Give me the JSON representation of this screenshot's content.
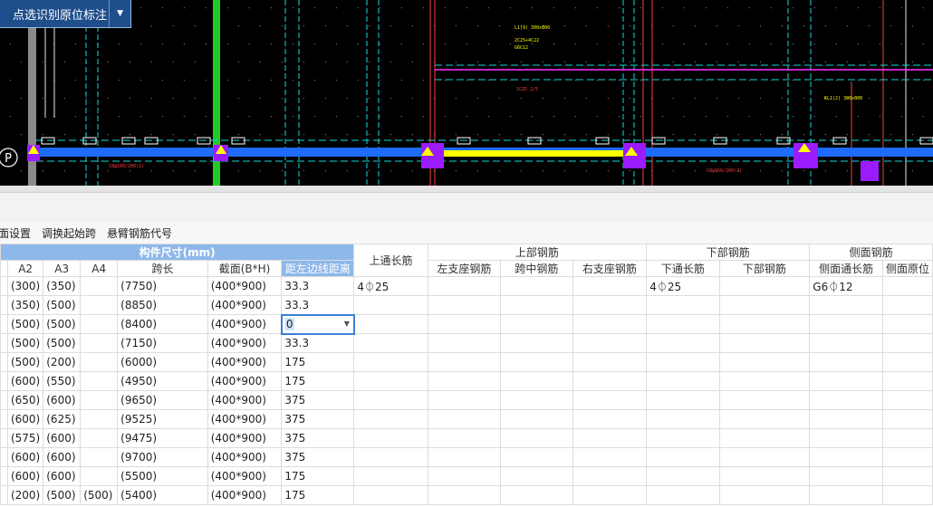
{
  "mode_button": {
    "label": "点选识别原位标注",
    "arrow": "▼"
  },
  "cad": {
    "axis_label": "P",
    "colors": {
      "bg": "#000000",
      "beam": "#1e6cff",
      "support": "#9b1bff",
      "grid_line": "#ff3030",
      "dim": "#ffffff",
      "text_yellow": "#ffff00",
      "column": "#22cc22"
    },
    "annotations": [
      "1C25 2/5",
      "C8@100/200(2)",
      "C8@150/200(2)",
      "2C25+4C22",
      "G6C12",
      "L1(9) 300x800",
      "KL1(2) 300x800"
    ]
  },
  "toolbar": [
    "面设置",
    "调换起始跨",
    "悬臂钢筋代号"
  ],
  "grid": {
    "group_headers": {
      "member_size": "构件尺寸(mm)",
      "top_through": "上通长筋",
      "top_bars": "上部钢筋",
      "bottom_bars": "下部钢筋",
      "side_bars": "侧面钢筋"
    },
    "columns": [
      "A2",
      "A3",
      "A4",
      "跨长",
      "截面(B*H)",
      "距左边线距离",
      "左支座钢筋",
      "跨中钢筋",
      "右支座钢筋",
      "下通长筋",
      "下部钢筋",
      "侧面通长筋",
      "侧面原位"
    ],
    "rows": [
      {
        "a2": "(300)",
        "a3": "(350)",
        "a4": "",
        "span": "(7750)",
        "section": "(400*900)",
        "dist": "33.3",
        "top_through": "4⏀25",
        "bottom_through": "4⏀25",
        "side": "G6⏀12"
      },
      {
        "a2": "(350)",
        "a3": "(500)",
        "a4": "",
        "span": "(8850)",
        "section": "(400*900)",
        "dist": "33.3"
      },
      {
        "a2": "(500)",
        "a3": "(500)",
        "a4": "",
        "span": "(8400)",
        "section": "(400*900)",
        "dist": "0",
        "editing": true
      },
      {
        "a2": "(500)",
        "a3": "(500)",
        "a4": "",
        "span": "(7150)",
        "section": "(400*900)",
        "dist": "33.3"
      },
      {
        "a2": "(500)",
        "a3": "(200)",
        "a4": "",
        "span": "(6000)",
        "section": "(400*900)",
        "dist": "175"
      },
      {
        "a2": "(600)",
        "a3": "(550)",
        "a4": "",
        "span": "(4950)",
        "section": "(400*900)",
        "dist": "175"
      },
      {
        "a2": "(650)",
        "a3": "(600)",
        "a4": "",
        "span": "(9650)",
        "section": "(400*900)",
        "dist": "375"
      },
      {
        "a2": "(600)",
        "a3": "(625)",
        "a4": "",
        "span": "(9525)",
        "section": "(400*900)",
        "dist": "375"
      },
      {
        "a2": "(575)",
        "a3": "(600)",
        "a4": "",
        "span": "(9475)",
        "section": "(400*900)",
        "dist": "375"
      },
      {
        "a2": "(600)",
        "a3": "(600)",
        "a4": "",
        "span": "(9700)",
        "section": "(400*900)",
        "dist": "375"
      },
      {
        "a2": "(600)",
        "a3": "(600)",
        "a4": "",
        "span": "(5500)",
        "section": "(400*900)",
        "dist": "175"
      },
      {
        "a2": "(200)",
        "a3": "(500)",
        "a4": "(500)",
        "span": "(5400)",
        "section": "(400*900)",
        "dist": "175"
      }
    ]
  }
}
